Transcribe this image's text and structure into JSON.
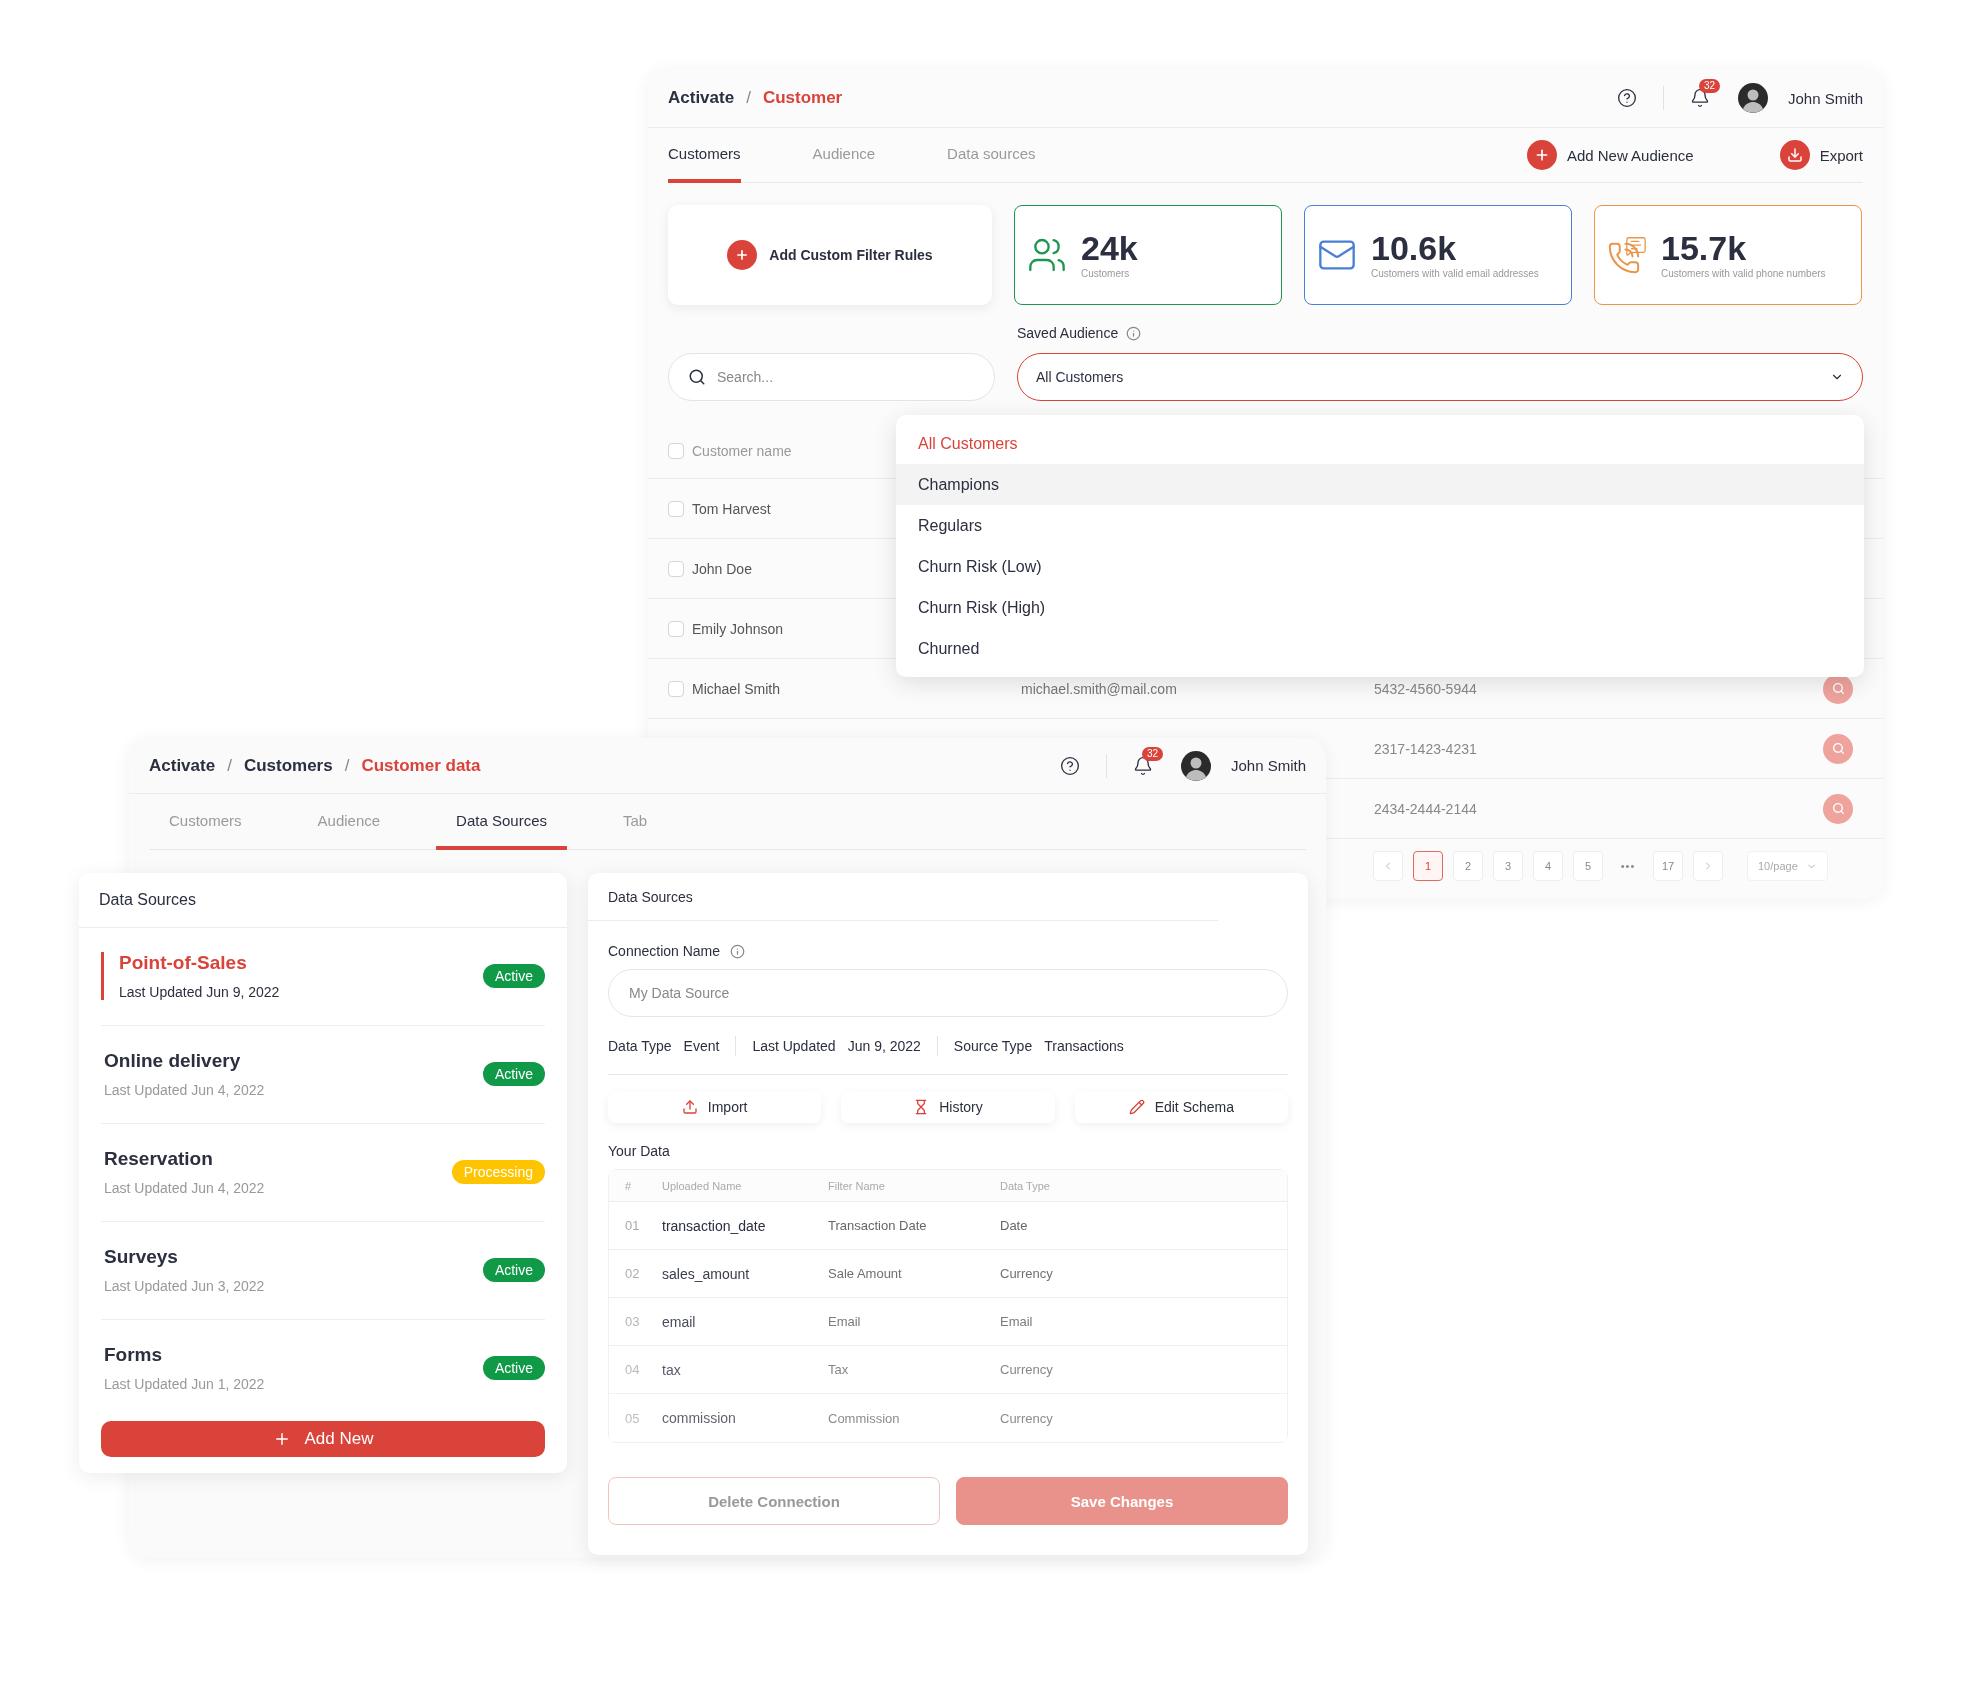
{
  "customer_window": {
    "breadcrumb": [
      {
        "label": "Activate",
        "current": false
      },
      {
        "label": "Customer",
        "current": true
      }
    ],
    "separator": "/",
    "notifications": "32",
    "user": "John Smith",
    "tabs": [
      {
        "label": "Customers",
        "selected": true
      },
      {
        "label": "Audience",
        "selected": false
      },
      {
        "label": "Data sources",
        "selected": false
      }
    ],
    "actions": [
      {
        "label": "Add New Audience",
        "kind": "add"
      },
      {
        "label": "Export",
        "kind": "export"
      }
    ],
    "filter_card": "Add Custom Filter Rules",
    "stats": [
      {
        "value": "24k",
        "caption": "Customers",
        "kind": "people",
        "color": "#1e9650"
      },
      {
        "value": "10.6k",
        "caption": "Customers with valid email addresses",
        "kind": "email",
        "color": "#4a7fd6"
      },
      {
        "value": "15.7k",
        "caption": "Customers with valid phone numbers",
        "kind": "phone",
        "color": "#e8964a"
      }
    ],
    "search": {
      "placeholder": "Search..."
    },
    "saved_audience": {
      "label": "Saved Audience",
      "value": "All Customers",
      "expanded": true,
      "options": [
        {
          "label": "All Customers",
          "selected": true,
          "highlighted": false
        },
        {
          "label": "Champions",
          "selected": false,
          "highlighted": true
        },
        {
          "label": "Regulars",
          "selected": false,
          "highlighted": false
        },
        {
          "label": "Churn Risk (Low)",
          "selected": false,
          "highlighted": false
        },
        {
          "label": "Churn Risk (High)",
          "selected": false,
          "highlighted": false
        },
        {
          "label": "Churned",
          "selected": false,
          "highlighted": false
        }
      ]
    },
    "table": {
      "header": {
        "checked": false,
        "column_1": "Customer name"
      },
      "rows": [
        {
          "checked": false,
          "name": "Tom Harvest"
        },
        {
          "checked": false,
          "name": "John Doe"
        },
        {
          "checked": false,
          "name": "Emily Johnson"
        },
        {
          "checked": false,
          "name": "Michael Smith",
          "email": "michael.smith@mail.com",
          "phone": "5432-4560-5944"
        },
        {
          "phone": "2317-1423-4231"
        },
        {
          "phone": "2434-2444-2144"
        }
      ]
    },
    "pagination": {
      "items": [
        {
          "kind": "page",
          "label": "1",
          "selected": true
        },
        {
          "kind": "page",
          "label": "2",
          "selected": false
        },
        {
          "kind": "page",
          "label": "3",
          "selected": false
        },
        {
          "kind": "page",
          "label": "4",
          "selected": false
        },
        {
          "kind": "page",
          "label": "5",
          "selected": false
        },
        {
          "kind": "gap",
          "label": "•••"
        },
        {
          "kind": "page",
          "label": "17",
          "selected": false
        }
      ],
      "per_page": "10/page"
    }
  },
  "data_window": {
    "breadcrumb": [
      {
        "label": "Activate",
        "current": false
      },
      {
        "label": "Customers",
        "current": false
      },
      {
        "label": "Customer data",
        "current": true
      }
    ],
    "separator": "/",
    "notifications": "32",
    "user": "John Smith",
    "tabs": [
      {
        "label": "Customers",
        "selected": false
      },
      {
        "label": "Audience",
        "selected": false
      },
      {
        "label": "Data Sources",
        "selected": true
      },
      {
        "label": "Tab",
        "selected": false
      }
    ],
    "sources": {
      "title": "Data Sources",
      "items": [
        {
          "name": "Point-of-Sales",
          "updated": "Last Updated Jun 9, 2022",
          "status": "Active",
          "color": "#109a48",
          "selected": true
        },
        {
          "name": "Online delivery",
          "updated": "Last Updated Jun 4, 2022",
          "status": "Active",
          "color": "#109a48",
          "selected": false
        },
        {
          "name": "Reservation",
          "updated": "Last Updated Jun 4, 2022",
          "status": "Processing",
          "color": "#ffc400",
          "selected": false
        },
        {
          "name": "Surveys",
          "updated": "Last Updated Jun 3, 2022",
          "status": "Active",
          "color": "#109a48",
          "selected": false
        },
        {
          "name": "Forms",
          "updated": "Last Updated Jun 1, 2022",
          "status": "Active",
          "color": "#109a48",
          "selected": false
        }
      ],
      "add_button": "Add New"
    },
    "detail": {
      "title": "Data Sources",
      "field_label": "Connection Name",
      "placeholder": "My Data Source",
      "meta": [
        {
          "label": "Data Type",
          "value": "Event"
        },
        {
          "label": "Last Updated",
          "value": "Jun 9, 2022"
        },
        {
          "label": "Source Type",
          "value": "Transactions"
        }
      ],
      "tools": [
        {
          "label": "Import",
          "kind": "import"
        },
        {
          "label": "History",
          "kind": "history"
        },
        {
          "label": "Edit Schema",
          "kind": "edit"
        }
      ],
      "section": "Your Data",
      "columns": [
        "#",
        "Uploaded Name",
        "Filter Name",
        "Data Type"
      ],
      "rows": [
        {
          "index": "01",
          "uploaded": "transaction_date",
          "filter": "Transaction Date",
          "type": "Date"
        },
        {
          "index": "02",
          "uploaded": "sales_amount",
          "filter": "Sale Amount",
          "type": "Currency"
        },
        {
          "index": "03",
          "uploaded": "email",
          "filter": "Email",
          "type": "Email"
        },
        {
          "index": "04",
          "uploaded": "tax",
          "filter": "Tax",
          "type": "Currency"
        },
        {
          "index": "05",
          "uploaded": "commission",
          "filter": "Commission",
          "type": "Currency"
        }
      ],
      "buttons": [
        {
          "label": "Delete Connection",
          "kind": "secondary"
        },
        {
          "label": "Save Changes",
          "kind": "primary"
        }
      ]
    }
  }
}
